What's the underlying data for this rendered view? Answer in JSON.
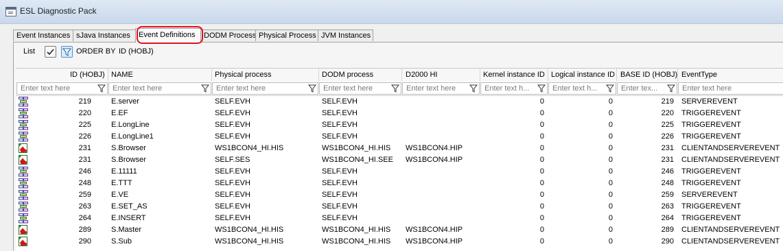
{
  "window": {
    "title": "ESL Diagnostic Pack"
  },
  "tabs": [
    {
      "label": "Event Instances"
    },
    {
      "label": "sJava Instances"
    },
    {
      "label": "Event Definitions"
    },
    {
      "label": "DODM Process"
    },
    {
      "label": "Physical Process"
    },
    {
      "label": "JVM Instances"
    }
  ],
  "active_tab": "Event Definitions",
  "toolbar": {
    "list_label": "List",
    "order_by_label": "ORDER BY",
    "order_by_value": "ID (HOBJ)"
  },
  "colors": {
    "highlight": "#e2111b",
    "active_button": "#d9ecfb"
  },
  "columns": [
    {
      "label": "ID (HOBJ)",
      "placeholder": "Enter text here"
    },
    {
      "label": "NAME",
      "placeholder": "Enter text here"
    },
    {
      "label": "Physical process",
      "placeholder": "Enter text here"
    },
    {
      "label": "DODM process",
      "placeholder": "Enter text here"
    },
    {
      "label": "D2000 HI",
      "placeholder": "Enter text here"
    },
    {
      "label": "Kernel instance ID",
      "placeholder": "Enter text h..."
    },
    {
      "label": "Logical instance ID",
      "placeholder": "Enter text h..."
    },
    {
      "label": "BASE ID (HOBJ)",
      "placeholder": "Enter tex..."
    },
    {
      "label": "EventType",
      "placeholder": "Enter text here"
    }
  ],
  "rows": [
    {
      "icon": "server-event-icon",
      "id": "219",
      "name": "E.server",
      "physical": "SELF.EVH",
      "dodm": "SELF.EVH",
      "hi": "",
      "kernel": "0",
      "logical": "0",
      "base": "219",
      "type": "SERVEREVENT"
    },
    {
      "icon": "server-event-icon",
      "id": "220",
      "name": "E.EF",
      "physical": "SELF.EVH",
      "dodm": "SELF.EVH",
      "hi": "",
      "kernel": "0",
      "logical": "0",
      "base": "220",
      "type": "TRIGGEREVENT"
    },
    {
      "icon": "server-event-icon",
      "id": "225",
      "name": "E.LongLine",
      "physical": "SELF.EVH",
      "dodm": "SELF.EVH",
      "hi": "",
      "kernel": "0",
      "logical": "0",
      "base": "225",
      "type": "TRIGGEREVENT"
    },
    {
      "icon": "server-event-icon",
      "id": "226",
      "name": "E.LongLine1",
      "physical": "SELF.EVH",
      "dodm": "SELF.EVH",
      "hi": "",
      "kernel": "0",
      "logical": "0",
      "base": "226",
      "type": "TRIGGEREVENT"
    },
    {
      "icon": "client-server-event-icon",
      "id": "231",
      "name": "S.Browser",
      "physical": "WS1BCON4_HI.HIS",
      "dodm": "WS1BCON4_HI.HIS",
      "hi": "WS1BCON4.HIP",
      "kernel": "0",
      "logical": "0",
      "base": "231",
      "type": "CLIENTANDSERVEREVENT"
    },
    {
      "icon": "client-server-event-icon",
      "id": "231",
      "name": "S.Browser",
      "physical": "SELF.SES",
      "dodm": "WS1BCON4_HI.SEE",
      "hi": "WS1BCON4.HIP",
      "kernel": "0",
      "logical": "0",
      "base": "231",
      "type": "CLIENTANDSERVEREVENT"
    },
    {
      "icon": "server-event-icon",
      "id": "246",
      "name": "E.11111",
      "physical": "SELF.EVH",
      "dodm": "SELF.EVH",
      "hi": "",
      "kernel": "0",
      "logical": "0",
      "base": "246",
      "type": "TRIGGEREVENT"
    },
    {
      "icon": "server-event-icon",
      "id": "248",
      "name": "E.TTT",
      "physical": "SELF.EVH",
      "dodm": "SELF.EVH",
      "hi": "",
      "kernel": "0",
      "logical": "0",
      "base": "248",
      "type": "TRIGGEREVENT"
    },
    {
      "icon": "server-event-icon",
      "id": "259",
      "name": "E.VE",
      "physical": "SELF.EVH",
      "dodm": "SELF.EVH",
      "hi": "",
      "kernel": "0",
      "logical": "0",
      "base": "259",
      "type": "SERVEREVENT"
    },
    {
      "icon": "server-event-icon",
      "id": "263",
      "name": "E.SET_AS",
      "physical": "SELF.EVH",
      "dodm": "SELF.EVH",
      "hi": "",
      "kernel": "0",
      "logical": "0",
      "base": "263",
      "type": "TRIGGEREVENT"
    },
    {
      "icon": "server-event-icon",
      "id": "264",
      "name": "E.INSERT",
      "physical": "SELF.EVH",
      "dodm": "SELF.EVH",
      "hi": "",
      "kernel": "0",
      "logical": "0",
      "base": "264",
      "type": "TRIGGEREVENT"
    },
    {
      "icon": "client-server-event-icon",
      "id": "289",
      "name": "S.Master",
      "physical": "WS1BCON4_HI.HIS",
      "dodm": "WS1BCON4_HI.HIS",
      "hi": "WS1BCON4.HIP",
      "kernel": "0",
      "logical": "0",
      "base": "289",
      "type": "CLIENTANDSERVEREVENT"
    },
    {
      "icon": "client-server-event-icon",
      "id": "290",
      "name": "S.Sub",
      "physical": "WS1BCON4_HI.HIS",
      "dodm": "WS1BCON4_HI.HIS",
      "hi": "WS1BCON4.HIP",
      "kernel": "0",
      "logical": "0",
      "base": "290",
      "type": "CLIENTANDSERVEREVENT"
    }
  ]
}
